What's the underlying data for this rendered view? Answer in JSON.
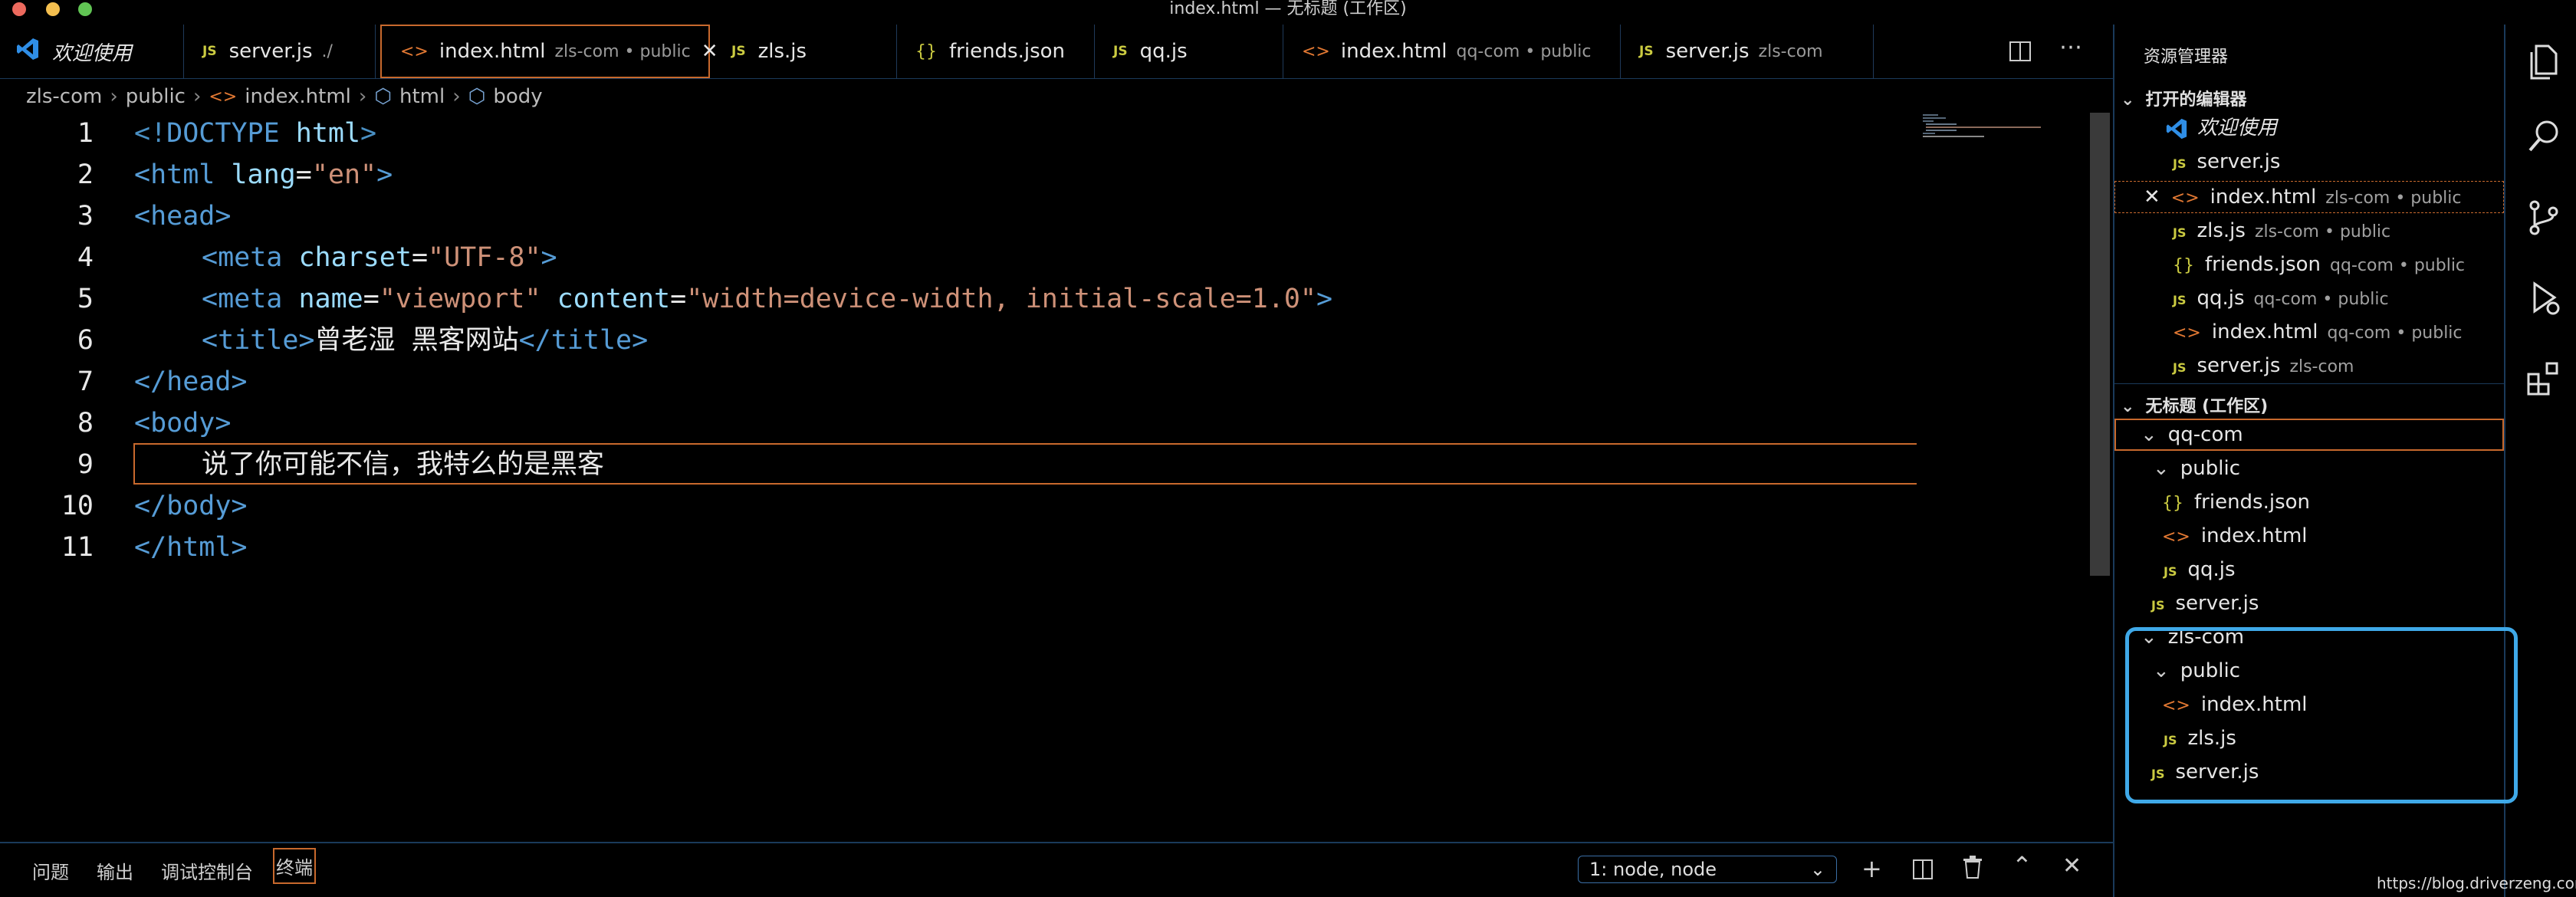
{
  "window": {
    "title": "index.html — 无标题 (工作区)"
  },
  "tabs": [
    {
      "label": "欢迎使用",
      "desc": "",
      "icon": "vscode-logo-icon"
    },
    {
      "label": "server.js",
      "desc": "./",
      "icon": "js-icon"
    },
    {
      "label": "index.html",
      "desc": "zls-com • public",
      "icon": "html-icon"
    },
    {
      "label": "zls.js",
      "desc": "",
      "icon": "js-icon"
    },
    {
      "label": "friends.json",
      "desc": "",
      "icon": "json-icon"
    },
    {
      "label": "qq.js",
      "desc": "",
      "icon": "js-icon"
    },
    {
      "label": "index.html",
      "desc": "qq-com • public",
      "icon": "html-icon"
    },
    {
      "label": "server.js",
      "desc": "zls-com",
      "icon": "js-icon"
    }
  ],
  "breadcrumb": [
    "zls-com",
    "public",
    "index.html",
    "html",
    "body"
  ],
  "editor": {
    "line_numbers": [
      "1",
      "2",
      "3",
      "4",
      "5",
      "6",
      "7",
      "8",
      "9",
      "10",
      "11"
    ],
    "line1": {
      "lt": "<!",
      "doctype": "DOCTYPE",
      "html": "html",
      "gt": ">"
    },
    "line2": {
      "open": "<html",
      "attr": "lang",
      "eq": "=",
      "val": "\"en\"",
      "close": ">"
    },
    "line3": {
      "text": "<head>"
    },
    "line4": {
      "open": "<meta",
      "attr": "charset",
      "eq": "=",
      "val": "\"UTF-8\"",
      "close": ">"
    },
    "line5": {
      "open": "<meta",
      "attr1": "name",
      "eq1": "=",
      "val1": "\"viewport\"",
      "attr2": "content",
      "eq2": "=",
      "val2": "\"width=device-width, initial-scale=1.0\"",
      "close": ">"
    },
    "line6": {
      "open": "<title>",
      "text": "曾老湿 黑客网站",
      "close": "</title>"
    },
    "line7": {
      "text": "</head>"
    },
    "line8": {
      "text": "<body>"
    },
    "line9": {
      "text": "说了你可能不信，我特么的是黑客"
    },
    "line10": {
      "text": "</body>"
    },
    "line11": {
      "text": "</html>"
    }
  },
  "panel": {
    "tabs": [
      "问题",
      "输出",
      "调试控制台",
      "终端"
    ],
    "terminal_select": "1: node, node"
  },
  "sidebar": {
    "title": "资源管理器",
    "open_editors_header": "打开的编辑器",
    "open_editors": [
      {
        "label": "欢迎使用",
        "desc": "",
        "icon": "vscode-logo-icon"
      },
      {
        "label": "server.js",
        "desc": "",
        "icon": "js-icon"
      },
      {
        "label": "index.html",
        "desc": "zls-com • public",
        "icon": "html-icon"
      },
      {
        "label": "zls.js",
        "desc": "zls-com • public",
        "icon": "js-icon"
      },
      {
        "label": "friends.json",
        "desc": "qq-com • public",
        "icon": "json-icon"
      },
      {
        "label": "qq.js",
        "desc": "qq-com • public",
        "icon": "js-icon"
      },
      {
        "label": "index.html",
        "desc": "qq-com • public",
        "icon": "html-icon"
      },
      {
        "label": "server.js",
        "desc": "zls-com",
        "icon": "js-icon"
      }
    ],
    "workspace_header": "无标题 (工作区)",
    "tree": {
      "qq_com": "qq-com",
      "qq_public": "public",
      "qq_friends": "friends.json",
      "qq_index": "index.html",
      "qq_qqjs": "qq.js",
      "qq_server": "server.js",
      "zls_com": "zls-com",
      "zls_public": "public",
      "zls_index": "index.html",
      "zls_zlsjs": "zls.js",
      "zls_server": "server.js"
    }
  },
  "watermark": "https://blog.driverzeng.com",
  "colors": {
    "accent_border": "#c8692d",
    "annotation": "#3fa9e8",
    "js": "#cbcb41",
    "html": "#e37933",
    "tag": "#569cd6",
    "attr": "#9cdcfe",
    "string": "#ce9178"
  }
}
